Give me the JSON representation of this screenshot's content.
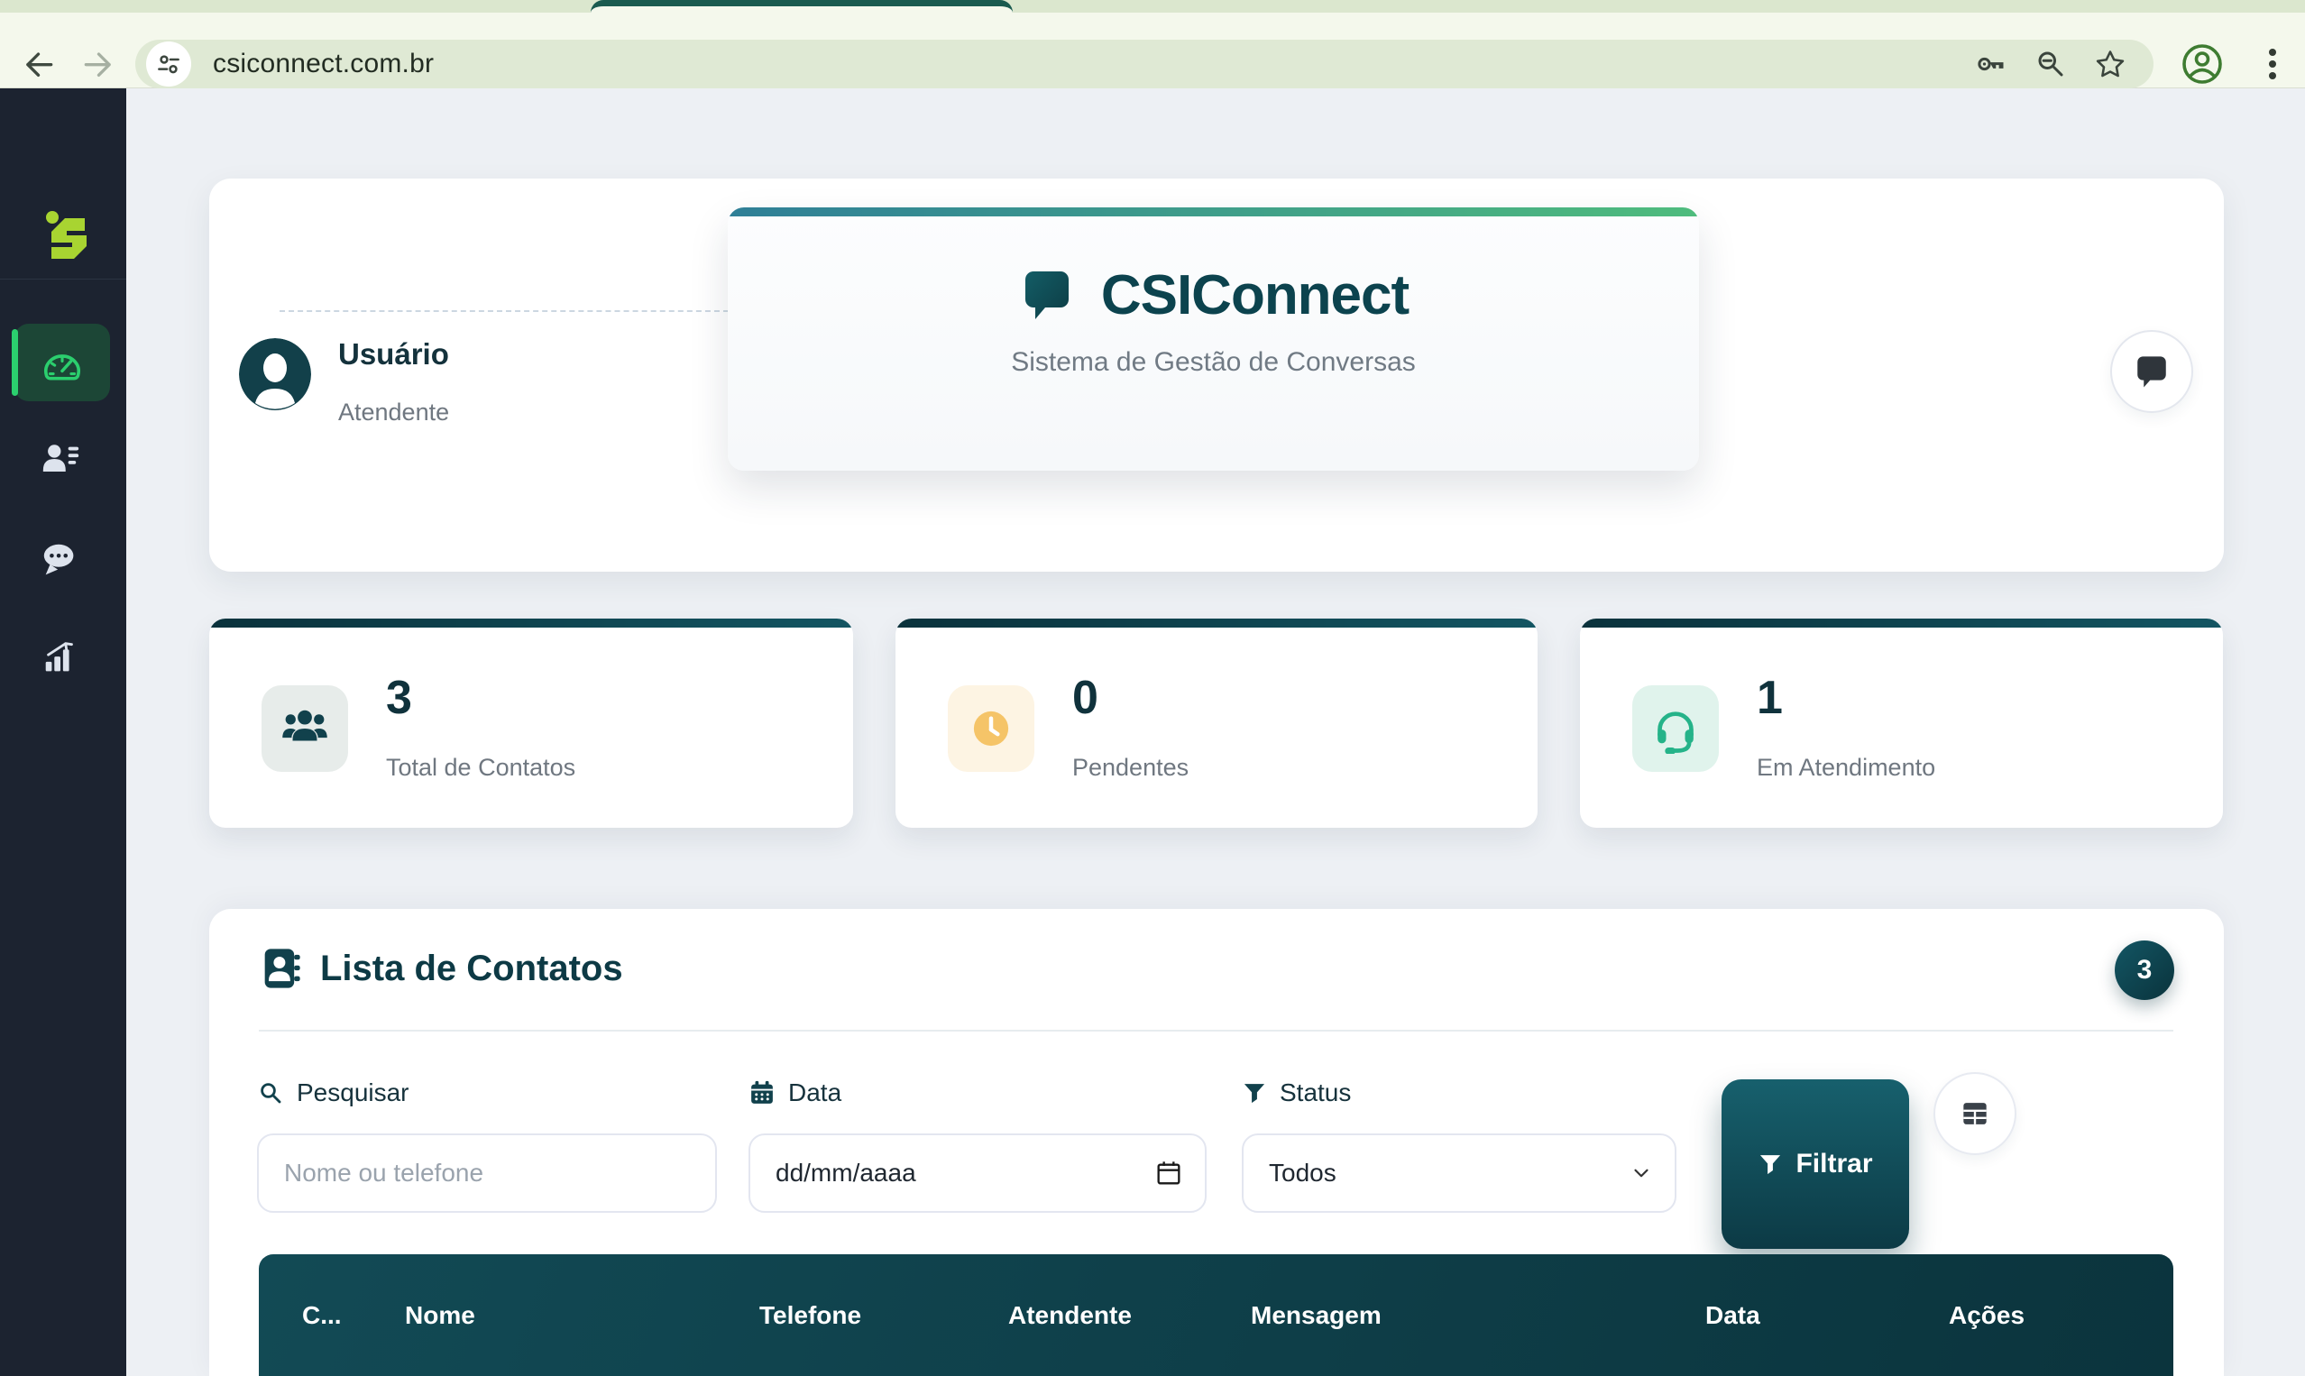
{
  "browser": {
    "url": "csiconnect.com.br"
  },
  "sidebar": {
    "items": [
      {
        "id": "dashboard",
        "icon": "gauge-icon",
        "active": true
      },
      {
        "id": "contacts",
        "icon": "users-icon",
        "active": false
      },
      {
        "id": "conversations",
        "icon": "chat-icon",
        "active": false
      },
      {
        "id": "reports",
        "icon": "chart-icon",
        "active": false
      }
    ]
  },
  "header": {
    "user": {
      "name": "Usuário",
      "role": "Atendente"
    },
    "app": {
      "title": "CSIConnect",
      "subtitle": "Sistema de Gestão de Conversas"
    }
  },
  "stats": [
    {
      "value": "3",
      "label": "Total de Contatos",
      "icon": "people-group-icon"
    },
    {
      "value": "0",
      "label": "Pendentes",
      "icon": "clock-icon"
    },
    {
      "value": "1",
      "label": "Em Atendimento",
      "icon": "headset-icon"
    }
  ],
  "contacts": {
    "title": "Lista de Contatos",
    "count": "3",
    "filters": {
      "search": {
        "label": "Pesquisar",
        "placeholder": "Nome ou telefone",
        "value": ""
      },
      "date": {
        "label": "Data",
        "placeholder": "dd/mm/aaaa",
        "value": ""
      },
      "status": {
        "label": "Status",
        "selected": "Todos"
      },
      "submit_label": "Filtrar"
    },
    "table": {
      "columns": [
        "C...",
        "Nome",
        "Telefone",
        "Atendente",
        "Mensagem",
        "Data",
        "Ações"
      ]
    }
  },
  "colors": {
    "accent_teal_dark": "#0c3a45",
    "accent_teal": "#135664",
    "header_gradient_start": "#2f7f97",
    "header_gradient_end": "#4fbc7d",
    "sidebar_bg": "#1c2330",
    "sidebar_active_green": "#2bcf6e",
    "logo_lime": "#a8d431",
    "chrome_bg": "#f4f8ec",
    "chrome_pill": "#dfe9d4",
    "page_bg": "#edf0f4",
    "warning_amber": "#f5c468",
    "success_green": "#25b389"
  }
}
